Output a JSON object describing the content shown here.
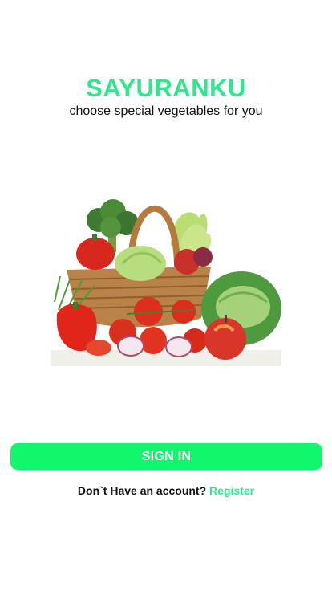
{
  "app": {
    "title": "SAYURANKU",
    "tagline": "choose special vegetables for you"
  },
  "hero": {
    "icon": "vegetable-basket-illustration"
  },
  "actions": {
    "sign_in_label": "SIGN IN",
    "account_prompt": "Don`t Have an account?",
    "register_label": "Register"
  },
  "colors": {
    "brand": "#2ce88c",
    "button": "#12f66e",
    "button_text": "#ffffff",
    "text": "#111111"
  }
}
